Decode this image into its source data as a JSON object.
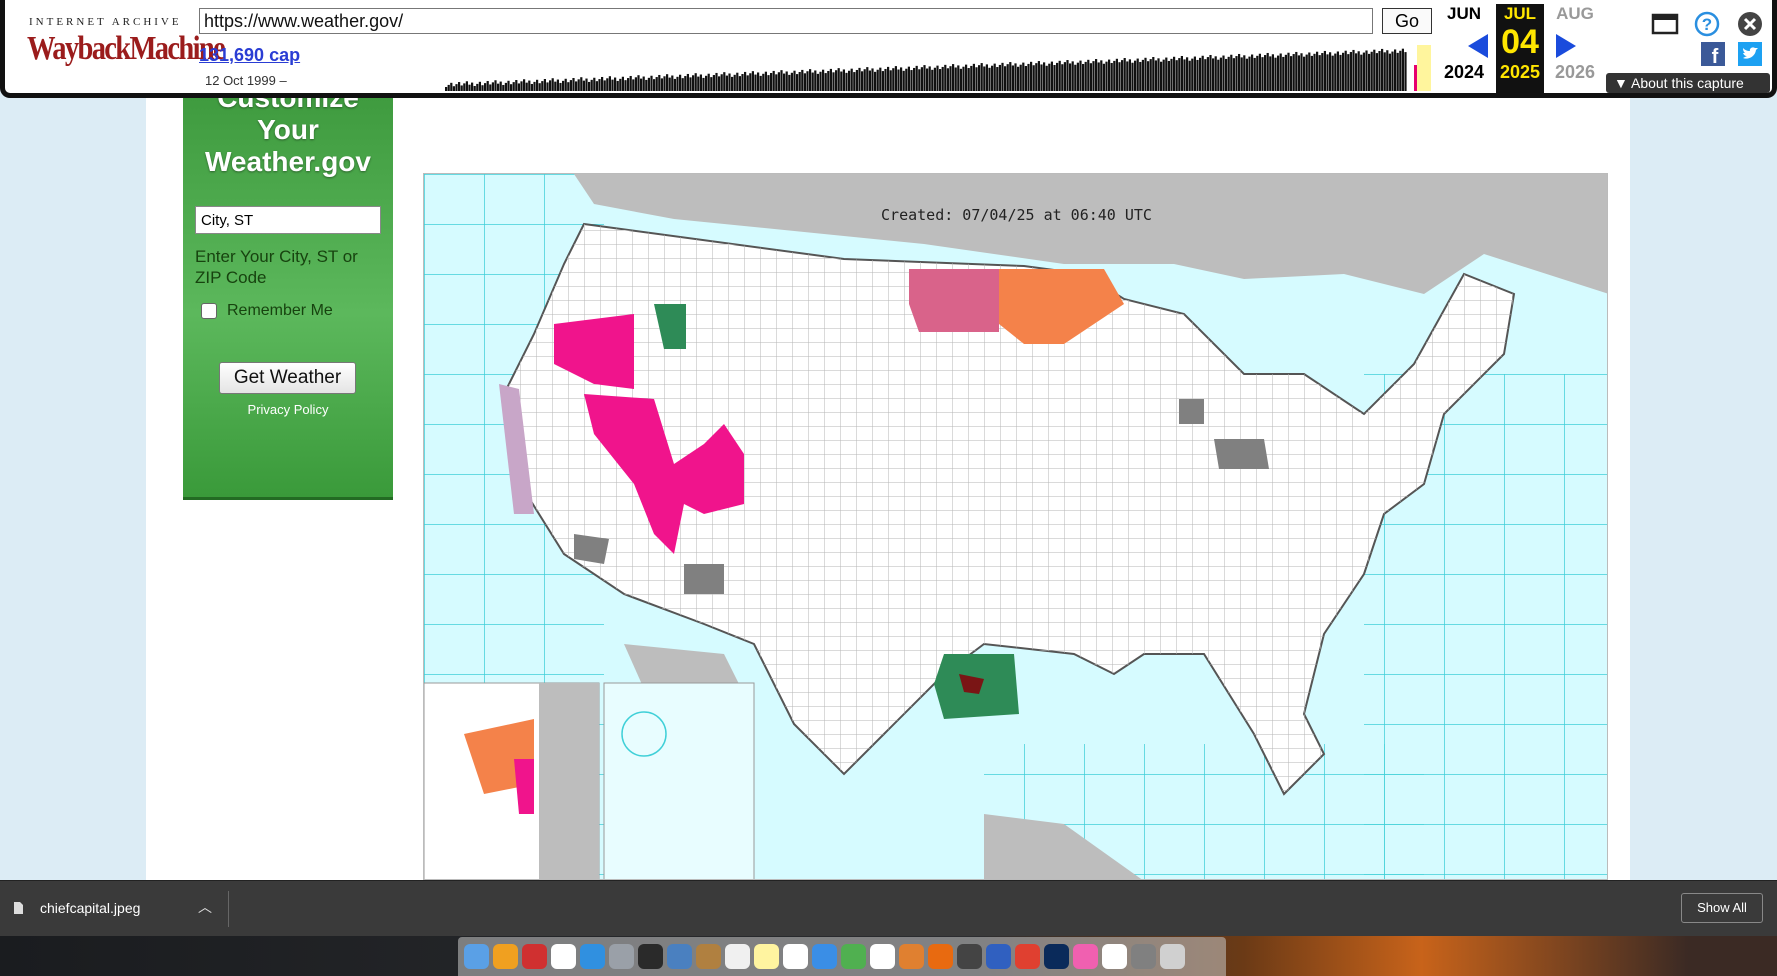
{
  "wayback": {
    "label_top": "INTERNET ARCHIVE",
    "label_logo": "WaybackMachine",
    "url": "https://www.weather.gov/",
    "go_label": "Go",
    "captures": "131,690 cap",
    "since": "12 Oct 1999 –",
    "calendar": [
      {
        "month": "JUN",
        "day": "",
        "year": "2024"
      },
      {
        "month": "JUL",
        "day": "04",
        "year": "2025"
      },
      {
        "month": "AUG",
        "day": "",
        "year": "2026"
      }
    ],
    "about_label": "About this capture",
    "icons": [
      "window-icon",
      "help-icon",
      "close-icon",
      "facebook-icon",
      "twitter-icon"
    ]
  },
  "customize": {
    "title_1": "Customize",
    "title_2": "Your",
    "title_3": "Weather.gov",
    "city_value": "City, ST",
    "hint": "Enter Your City, ST or ZIP Code",
    "remember_label": "Remember Me",
    "button_label": "Get Weather",
    "privacy_label": "Privacy Policy"
  },
  "map": {
    "created": "Created: 07/04/25 at 06:40 UTC"
  },
  "download": {
    "filename": "chiefcapital.jpeg",
    "show_all": "Show All"
  },
  "colors": {
    "warning_pink": "#f0148c",
    "red_flag_orange": "#f4824a",
    "heat_advisory_rose": "#d9638a",
    "flood_green": "#2e8b57",
    "gray_advisory": "#808080",
    "marine_cyan": "#40d0d8",
    "ocean": "#d6fbff",
    "land_gray": "#bdbdbd"
  }
}
